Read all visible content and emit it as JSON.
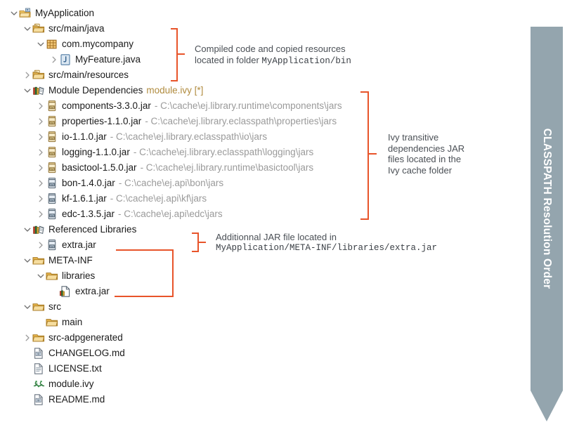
{
  "tree": {
    "nodes": [
      {
        "indent": 0,
        "twisty": "expanded",
        "icon": "project-icon",
        "label": "MyApplication"
      },
      {
        "indent": 1,
        "twisty": "expanded",
        "icon": "source-folder-icon",
        "label": "src/main/java"
      },
      {
        "indent": 2,
        "twisty": "expanded",
        "icon": "package-icon",
        "label": "com.mycompany"
      },
      {
        "indent": 3,
        "twisty": "collapsed",
        "icon": "java-file-icon",
        "label": "MyFeature.java"
      },
      {
        "indent": 1,
        "twisty": "collapsed",
        "icon": "source-folder-icon",
        "label": "src/main/resources"
      },
      {
        "indent": 1,
        "twisty": "expanded",
        "icon": "library-icon",
        "label": "Module Dependencies",
        "ivy": "module.ivy [*]"
      },
      {
        "indent": 2,
        "twisty": "collapsed",
        "icon": "jar-library-icon",
        "label": "components-3.3.0.jar",
        "path": "- C:\\cache\\ej.library.runtime\\components\\jars"
      },
      {
        "indent": 2,
        "twisty": "collapsed",
        "icon": "jar-library-icon",
        "label": "properties-1.1.0.jar",
        "path": "- C:\\cache\\ej.library.eclasspath\\properties\\jars"
      },
      {
        "indent": 2,
        "twisty": "collapsed",
        "icon": "jar-library-icon",
        "label": "io-1.1.0.jar",
        "path": "- C:\\cache\\ej.library.eclasspath\\io\\jars"
      },
      {
        "indent": 2,
        "twisty": "collapsed",
        "icon": "jar-library-icon",
        "label": "logging-1.1.0.jar",
        "path": "- C:\\cache\\ej.library.eclasspath\\logging\\jars"
      },
      {
        "indent": 2,
        "twisty": "collapsed",
        "icon": "jar-library-icon",
        "label": "basictool-1.5.0.jar",
        "path": "- C:\\cache\\ej.library.runtime\\basictool\\jars"
      },
      {
        "indent": 2,
        "twisty": "collapsed",
        "icon": "jar-api-icon",
        "label": "bon-1.4.0.jar",
        "path": "- C:\\cache\\ej.api\\bon\\jars"
      },
      {
        "indent": 2,
        "twisty": "collapsed",
        "icon": "jar-api-icon",
        "label": "kf-1.6.1.jar",
        "path": "- C:\\cache\\ej.api\\kf\\jars"
      },
      {
        "indent": 2,
        "twisty": "collapsed",
        "icon": "jar-api-icon",
        "label": "edc-1.3.5.jar",
        "path": "- C:\\cache\\ej.api\\edc\\jars"
      },
      {
        "indent": 1,
        "twisty": "expanded",
        "icon": "library-icon",
        "label": "Referenced Libraries"
      },
      {
        "indent": 2,
        "twisty": "collapsed",
        "icon": "jar-api-icon",
        "label": "extra.jar"
      },
      {
        "indent": 1,
        "twisty": "expanded",
        "icon": "folder-icon",
        "label": "META-INF"
      },
      {
        "indent": 2,
        "twisty": "expanded",
        "icon": "folder-icon",
        "label": "libraries"
      },
      {
        "indent": 3,
        "twisty": "none",
        "icon": "jar-file-icon",
        "label": "extra.jar"
      },
      {
        "indent": 1,
        "twisty": "expanded",
        "icon": "folder-icon",
        "label": "src"
      },
      {
        "indent": 2,
        "twisty": "none",
        "icon": "folder-icon",
        "label": "main"
      },
      {
        "indent": 1,
        "twisty": "collapsed",
        "icon": "folder-icon",
        "label": "src-adpgenerated"
      },
      {
        "indent": 1,
        "twisty": "none",
        "icon": "markdown-file-icon",
        "label": "CHANGELOG.md"
      },
      {
        "indent": 1,
        "twisty": "none",
        "icon": "text-file-icon",
        "label": "LICENSE.txt"
      },
      {
        "indent": 1,
        "twisty": "none",
        "icon": "ivy-file-icon",
        "label": "module.ivy"
      },
      {
        "indent": 1,
        "twisty": "none",
        "icon": "markdown-file-icon",
        "label": "README.md"
      }
    ]
  },
  "callouts": {
    "compiled": {
      "line1": "Compiled code and copied resources",
      "line2_prefix": "located in folder ",
      "line2_mono": "MyApplication/bin"
    },
    "ivy": {
      "line1": "Ivy transitive",
      "line2": "dependencies JAR",
      "line3": "files located in the",
      "line4": "Ivy cache folder"
    },
    "extra": {
      "line1": "Additionnal JAR file located in",
      "line2_mono": "MyApplication/META-INF/libraries/extra.jar"
    }
  },
  "arrow": {
    "label": "CLASSPATH Resolution Order",
    "color": "#94a5ae"
  },
  "colors": {
    "bracket": "#e8542a",
    "path_text": "#9a9a9a",
    "ivy_text": "#b08b3e",
    "callout_text": "#4a4f55"
  }
}
